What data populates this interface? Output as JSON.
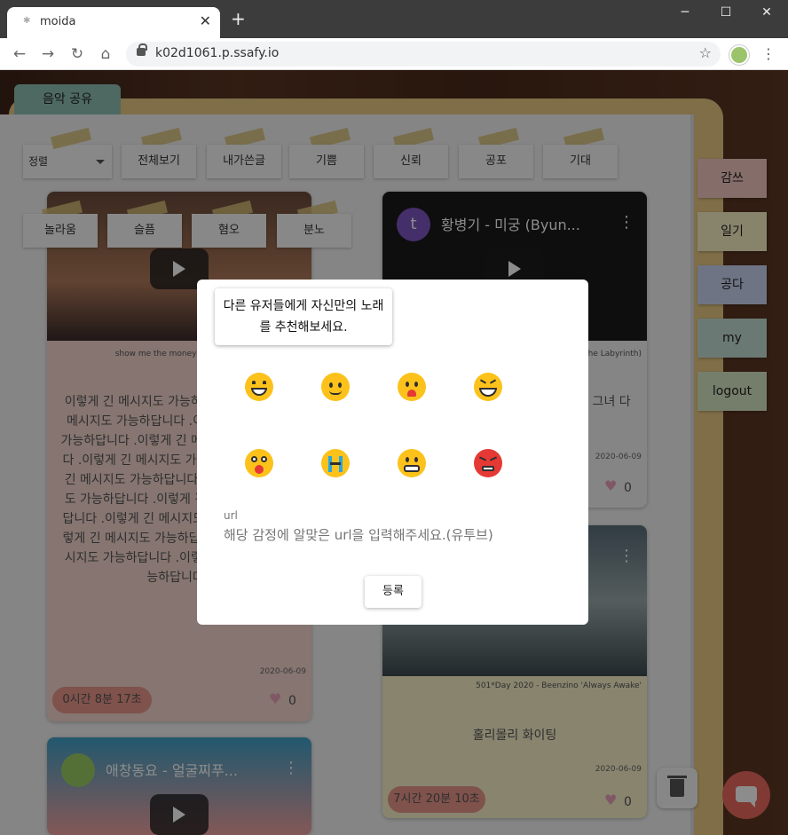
{
  "browser": {
    "tab_title": "moida",
    "url": "k02d1061.p.ssafy.io"
  },
  "page": {
    "music_tab": "음악 공유",
    "sort_label": "정렬",
    "filters_row1": [
      "전체보기",
      "내가쓴글",
      "기쁨",
      "신뢰",
      "공포",
      "기대"
    ],
    "filters_row2": [
      "놀라움",
      "슬픔",
      "혐오",
      "분노"
    ],
    "side_tabs": [
      "감쓰",
      "일기",
      "공다",
      "my",
      "logout"
    ],
    "cards": {
      "left1": {
        "caption": "show me the money6 [Full Ver...",
        "body": "이렇게 긴 메시지도 가능하답니다 .이렇게 긴 메시지도 가능하답니다 .이렇게 긴 메시지도 가능하답니다 .이렇게 긴 메시지도 가능하답니다 .이렇게 긴 메시지도 가능하답니다 .이렇게 긴 메시지도 가능하답니다 .이렇게 긴 메시지도 가능하답니다 .이렇게 긴 메시지도 가능하답니다 .이렇게 긴 메시지도 가능하답니다 .이렇게 긴 메시지도 가능하답니다 .이렇게 긴 메시지도 가능하답니다 .이렇게 긴 메시지도 가능하답니다 .",
        "date": "2020-06-09",
        "time": "0시간 8분 17초",
        "likes": "0"
      },
      "right1": {
        "channel_initial": "t",
        "title": "황병기 - 미궁 (Byun...",
        "caption": "he Labyrinth)",
        "body": "다.. 그녀 다",
        "date": "2020-06-09",
        "likes": "0"
      },
      "right2": {
        "caption": "501*Day 2020 - Beenzino 'Always Awake'",
        "body": "홀리몰리 화이팅",
        "date": "2020-06-09",
        "time": "7시간 20분 10초",
        "likes": "0"
      },
      "left2": {
        "title": "애창동요 - 얼굴찌푸..."
      }
    }
  },
  "modal": {
    "prompt_line1": "다른 유저들에게 자신만의 노래",
    "prompt_line2": "를 추천해보세요.",
    "emotions": [
      "joy-emoji",
      "trust-emoji",
      "fear-emoji",
      "anticipation-emoji",
      "surprise-emoji",
      "sadness-emoji",
      "disgust-emoji",
      "anger-emoji"
    ],
    "url_label": "url",
    "url_placeholder": "해당 감정에 알맞은 url을 입력해주세요.(유투브)",
    "submit_label": "등록"
  },
  "colors": {
    "binder": "#e8c983",
    "music_tab": "#8fbfb3",
    "pill": "#e8958b",
    "chat": "#e96b5e"
  }
}
